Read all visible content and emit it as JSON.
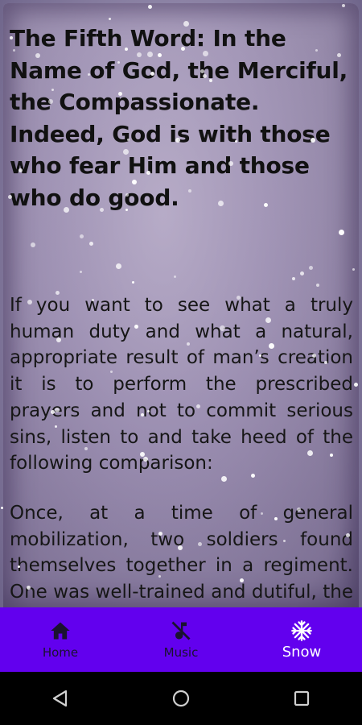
{
  "article": {
    "title": "The Fifth Word: In the Name of God, the Merciful, the Compassionate. Indeed, God is with those who fear Him and those who do good.",
    "paragraphs": [
      "If you want to see what a truly human duty and what a natural, appropriate result of man’s creation it is to perform the prescribed prayers and not to commit serious sins, listen to and take heed of the following comparison:",
      "Once, at a time of general mobilization, two soldiers found themselves together in a regiment. One was well-trained and dutiful, the other was a new recruit and selfish."
    ]
  },
  "bottom_nav": {
    "items": [
      {
        "label": "Home",
        "icon": "home-icon",
        "active": false
      },
      {
        "label": "Music",
        "icon": "music-off-icon",
        "active": false
      },
      {
        "label": "Snow",
        "icon": "snowflake-icon",
        "active": true
      }
    ],
    "accent": "#6200ee"
  },
  "system_nav": {
    "icons": [
      "back-icon",
      "home-circle-icon",
      "recents-icon"
    ]
  }
}
